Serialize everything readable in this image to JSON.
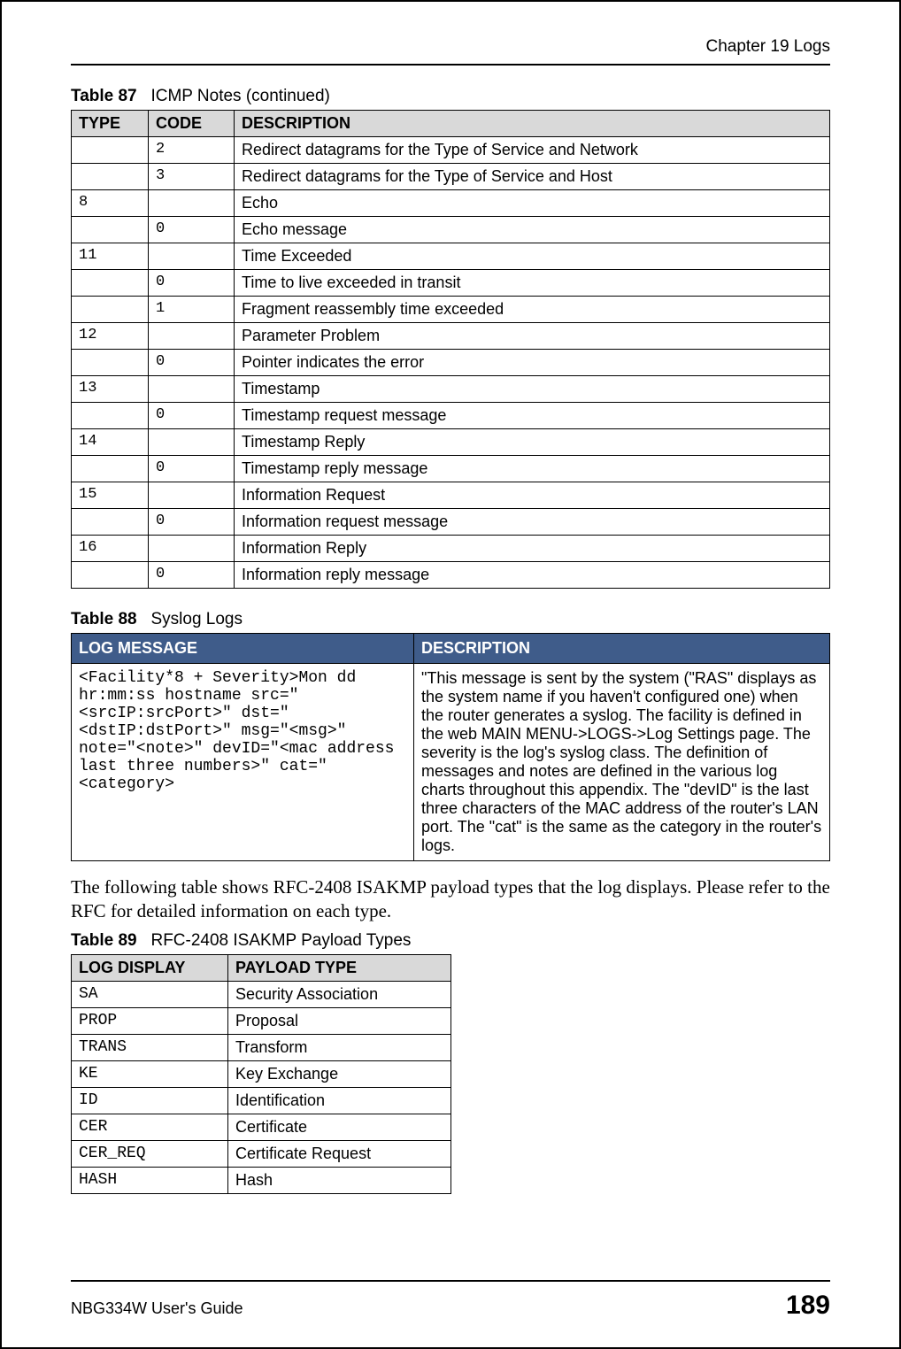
{
  "header": {
    "chapter": "Chapter 19 Logs"
  },
  "table87": {
    "caption_num": "Table 87",
    "caption_title": "ICMP Notes (continued)",
    "headers": {
      "type": "TYPE",
      "code": "CODE",
      "desc": "DESCRIPTION"
    },
    "rows": [
      {
        "type": "",
        "code": "2",
        "desc": "Redirect datagrams for the Type of Service and Network"
      },
      {
        "type": "",
        "code": "3",
        "desc": "Redirect datagrams for the Type of Service and Host"
      },
      {
        "type": "8",
        "code": "",
        "desc": "Echo"
      },
      {
        "type": "",
        "code": "0",
        "desc": "Echo message"
      },
      {
        "type": "11",
        "code": "",
        "desc": "Time Exceeded"
      },
      {
        "type": "",
        "code": "0",
        "desc": "Time to live exceeded in transit"
      },
      {
        "type": "",
        "code": "1",
        "desc": "Fragment reassembly time exceeded"
      },
      {
        "type": "12",
        "code": "",
        "desc": "Parameter Problem"
      },
      {
        "type": "",
        "code": "0",
        "desc": "Pointer indicates the error"
      },
      {
        "type": "13",
        "code": "",
        "desc": "Timestamp"
      },
      {
        "type": "",
        "code": "0",
        "desc": "Timestamp request message"
      },
      {
        "type": "14",
        "code": "",
        "desc": "Timestamp Reply"
      },
      {
        "type": "",
        "code": "0",
        "desc": "Timestamp reply message"
      },
      {
        "type": "15",
        "code": "",
        "desc": "Information Request"
      },
      {
        "type": "",
        "code": "0",
        "desc": "Information request message"
      },
      {
        "type": "16",
        "code": "",
        "desc": "Information Reply"
      },
      {
        "type": "",
        "code": "0",
        "desc": "Information reply message"
      }
    ]
  },
  "table88": {
    "caption_num": "Table 88",
    "caption_title": "Syslog Logs",
    "headers": {
      "msg": "LOG MESSAGE",
      "desc": "DESCRIPTION"
    },
    "row": {
      "msg": "<Facility*8 + Severity>Mon dd hr:mm:ss hostname src=\"<srcIP:srcPort>\" dst=\"<dstIP:dstPort>\" msg=\"<msg>\" note=\"<note>\" devID=\"<mac address last three numbers>\" cat=\"<category>",
      "desc": "\"This message is sent by the system (\"RAS\" displays as the system name if you haven't configured one) when the router generates a syslog. The facility is defined in the web MAIN MENU->LOGS->Log Settings page. The severity is the log's syslog class. The definition of messages and notes are defined in the various log charts throughout this appendix. The \"devID\" is the last three characters of the MAC address of the router's LAN port. The \"cat\" is the same as the category in the router's logs."
    }
  },
  "intro_text": "The following table shows RFC-2408 ISAKMP payload types that the log displays. Please refer to the RFC for detailed information on each type.",
  "table89": {
    "caption_num": "Table 89",
    "caption_title": "RFC-2408 ISAKMP Payload Types",
    "headers": {
      "disp": "LOG DISPLAY",
      "type": "PAYLOAD TYPE"
    },
    "rows": [
      {
        "disp": "SA",
        "type": "Security Association"
      },
      {
        "disp": "PROP",
        "type": "Proposal"
      },
      {
        "disp": "TRANS",
        "type": "Transform"
      },
      {
        "disp": "KE",
        "type": "Key Exchange"
      },
      {
        "disp": "ID",
        "type": "Identification"
      },
      {
        "disp": "CER",
        "type": "Certificate"
      },
      {
        "disp": "CER_REQ",
        "type": "Certificate Request"
      },
      {
        "disp": "HASH",
        "type": "Hash"
      }
    ]
  },
  "footer": {
    "guide": "NBG334W User's Guide",
    "page": "189"
  }
}
